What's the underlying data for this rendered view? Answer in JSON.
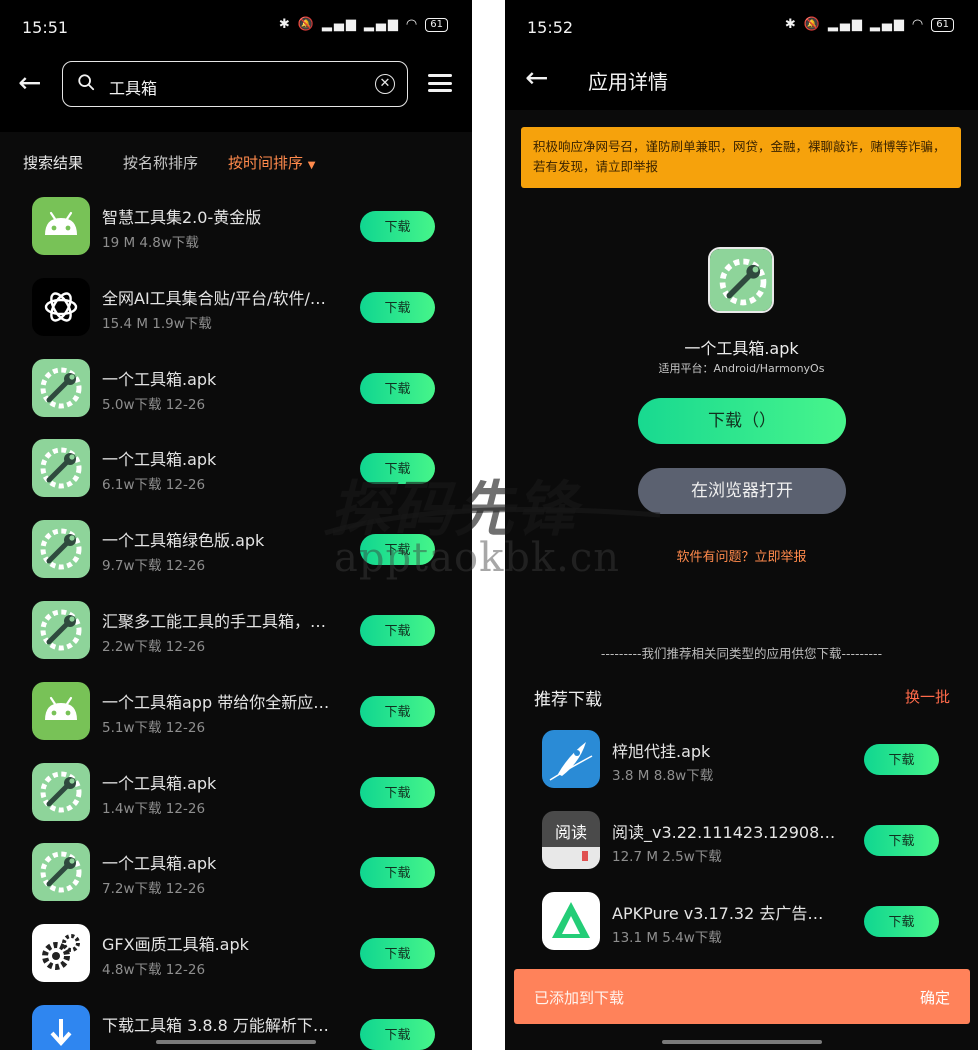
{
  "left_screen": {
    "status": {
      "time": "15:51",
      "battery": "61"
    },
    "search": {
      "query": "工具箱"
    },
    "filters": {
      "results_label": "搜索结果",
      "by_name": "按名称排序",
      "by_time": "按时间排序"
    },
    "items": [
      {
        "name": "智慧工具集2.0-黄金版",
        "meta": "19 M  4.8w下载",
        "icon": "android-icon",
        "button": "下载"
      },
      {
        "name": "全网AI工具集合贴/平台/软件/…",
        "meta": "15.4 M  1.9w下载",
        "icon": "openai-icon",
        "button": "下载"
      },
      {
        "name": "一个工具箱.apk",
        "meta": "5.0w下载  12-26",
        "icon": "wrench-gear-icon",
        "button": "下载"
      },
      {
        "name": "一个工具箱.apk",
        "meta": "6.1w下载  12-26",
        "icon": "wrench-gear-icon",
        "button": "下载"
      },
      {
        "name": "一个工具箱绿色版.apk",
        "meta": "9.7w下载  12-26",
        "icon": "wrench-gear-icon",
        "button": "下载"
      },
      {
        "name": "汇聚多工能工具的手工具箱，…",
        "meta": "2.2w下载  12-26",
        "icon": "wrench-gear-icon",
        "button": "下载"
      },
      {
        "name": "一个工具箱app 带给你全新应…",
        "meta": "5.1w下载  12-26",
        "icon": "android-icon",
        "button": "下载"
      },
      {
        "name": "一个工具箱.apk",
        "meta": "1.4w下载  12-26",
        "icon": "wrench-gear-icon",
        "button": "下载"
      },
      {
        "name": "一个工具箱.apk",
        "meta": "7.2w下载  12-26",
        "icon": "wrench-gear-icon",
        "button": "下载"
      },
      {
        "name": "GFX画质工具箱.apk",
        "meta": "4.8w下载  12-26",
        "icon": "gears-icon",
        "button": "下载"
      },
      {
        "name": "下载工具箱 3.8.8 万能解析下…",
        "meta": "",
        "icon": "download-icon",
        "button": "下载"
      }
    ]
  },
  "right_screen": {
    "status": {
      "time": "15:52",
      "battery": "61"
    },
    "title": "应用详情",
    "warning": "积极响应净网号召，谨防刷单兼职，网贷，金融，裸聊敲诈，赌博等诈骗，若有发现，请立即举报",
    "app": {
      "name": "一个工具箱.apk",
      "platform": "适用平台：Android/HarmonyOs"
    },
    "download_button": "下载（）",
    "browser_button": "在浏览器打开",
    "report_link": "软件有问题？立即举报",
    "recommend_divider": "---------我们推荐相关同类型的应用供您下载---------",
    "recommend_title": "推荐下载",
    "recommend_refresh": "换一批",
    "recommend": [
      {
        "name": "梓旭代挂.apk",
        "meta": "3.8 M  8.8w下载",
        "icon": "rocket-icon",
        "button": "下载"
      },
      {
        "name": "阅读_v3.22.111423.12908.apk",
        "meta": "12.7 M  2.5w下载",
        "icon": "book-icon",
        "button": "下载"
      },
      {
        "name": "APKPure v3.17.32 去广告版[…",
        "meta": "13.1 M  5.4w下载",
        "icon": "apkpure-icon",
        "button": "下载"
      }
    ],
    "toast": {
      "text": "已添加到下载",
      "confirm": "确定"
    }
  },
  "watermark": {
    "brand": "探码先锋",
    "url": "apptaokbk.cn"
  },
  "colors": {
    "accent_orange": "#ff8a4c",
    "download_green": "#2de88e",
    "warning_bg": "#f6a20c",
    "toast_bg": "#ff825a",
    "screen_bg": "#0b0b0b"
  }
}
